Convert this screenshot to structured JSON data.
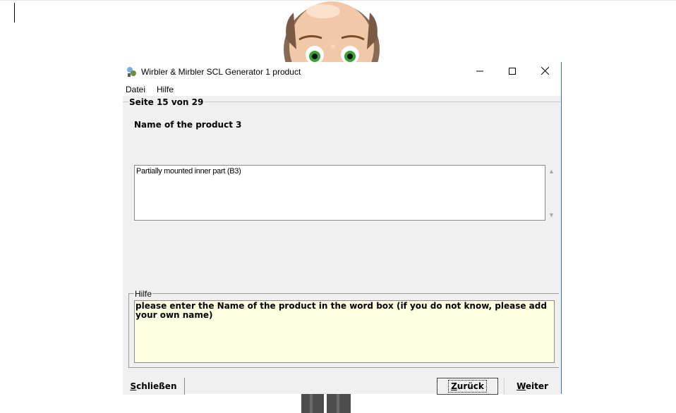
{
  "window": {
    "title": "Wirbler & Mirbler SCL Generator 1 product"
  },
  "menu": {
    "items": [
      "Datei",
      "Hilfe"
    ]
  },
  "page": {
    "legend": "Seite 15 von 29",
    "question": "Name of the product 3",
    "answer_value": "Partially mounted inner part (B3)"
  },
  "help": {
    "legend": "Hilfe",
    "text": "please enter the Name of the product in the word box (if you do not know, please add your own name)"
  },
  "buttons": {
    "close_first": "S",
    "close_rest": "chließen",
    "back_first": "Z",
    "back_rest": "urück",
    "next_first": "W",
    "next_rest": "eiter"
  },
  "colors": {
    "help_background": "#ffffe1",
    "window_border": "#2b6fb7"
  }
}
